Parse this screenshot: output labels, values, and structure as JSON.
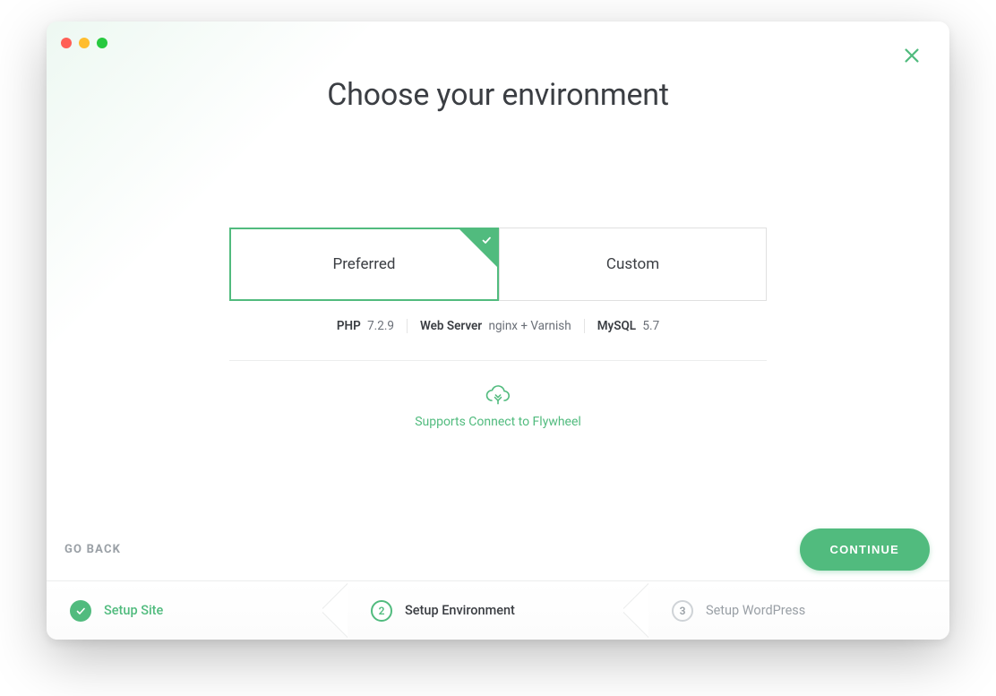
{
  "header": {
    "title": "Choose your environment"
  },
  "environment": {
    "options": [
      {
        "label": "Preferred",
        "selected": true
      },
      {
        "label": "Custom",
        "selected": false
      }
    ],
    "specs": {
      "php": {
        "label": "PHP",
        "value": "7.2.9"
      },
      "web": {
        "label": "Web Server",
        "value": "nginx + Varnish"
      },
      "mysql": {
        "label": "MySQL",
        "value": "5.7"
      }
    },
    "flywheel_text": "Supports Connect to Flywheel"
  },
  "nav": {
    "back_label": "GO BACK",
    "continue_label": "CONTINUE"
  },
  "stepper": [
    {
      "num": "1",
      "label": "Setup Site",
      "state": "done"
    },
    {
      "num": "2",
      "label": "Setup Environment",
      "state": "active"
    },
    {
      "num": "3",
      "label": "Setup WordPress",
      "state": "todo"
    }
  ]
}
